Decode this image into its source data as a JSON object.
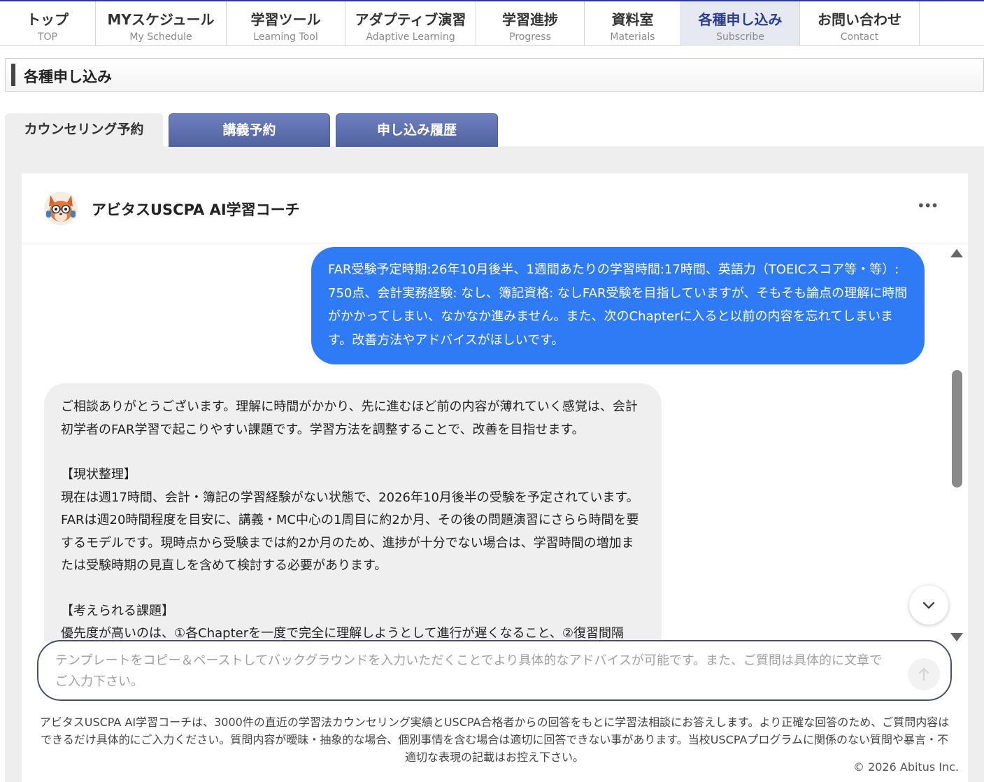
{
  "nav": {
    "items": [
      {
        "jp": "トップ",
        "en": "TOP",
        "active": false
      },
      {
        "jp": "MYスケジュール",
        "en": "My Schedule",
        "active": false
      },
      {
        "jp": "学習ツール",
        "en": "Learning Tool",
        "active": false
      },
      {
        "jp": "アダプティブ演習",
        "en": "Adaptive Learning",
        "active": false
      },
      {
        "jp": "学習進捗",
        "en": "Progress",
        "active": false
      },
      {
        "jp": "資料室",
        "en": "Materials",
        "active": false
      },
      {
        "jp": "各種申し込み",
        "en": "Subscribe",
        "active": true
      },
      {
        "jp": "お問い合わせ",
        "en": "Contact",
        "active": false
      }
    ]
  },
  "page": {
    "title": "各種申し込み"
  },
  "tabs": [
    {
      "label": "カウンセリング予約",
      "active": true
    },
    {
      "label": "講義予約",
      "active": false
    },
    {
      "label": "申し込み履歴",
      "active": false
    }
  ],
  "chat": {
    "bot_name": "アビタスUSCPA AI学習コーチ",
    "more_label": "•••",
    "avatar_icon": "fox-mascot-icon",
    "user_message": "FAR受験予定時期:26年10月後半、1週間あたりの学習時間:17時間、英語力（TOEICスコア等・等）: 750点、会計実務経験: なし、簿記資格: なしFAR受験を目指していますが、そもそも論点の理解に時間がかかってしまい、なかなか進みません。また、次のChapterに入ると以前の内容を忘れてしまいます。改善方法やアドバイスがほしいです。",
    "bot_message": {
      "intro": "ご相談ありがとうございます。理解に時間がかかり、先に進むほど前の内容が薄れていく感覚は、会計初学者のFAR学習で起こりやすい課題です。学習方法を調整することで、改善を目指せます。",
      "section1_title": "【現状整理】",
      "section1_body": "現在は週17時間、会計・簿記の学習経験がない状態で、2026年10月後半の受験を予定されています。FARは週20時間程度を目安に、講義・MC中心の1周目に約2か月、その後の問題演習にさらら時間を要するモデルです。現時点から受験までは約2か月のため、進捗が十分でない場合は、学習時間の増加または受験時期の見直しを含めて検討する必要があります。",
      "section2_title": "【考えられる課題】",
      "section2_body": "優先度が高いのは、①各Chapterを一度で完全に理解しようとして進行が遅くなること、②復習間隔"
    },
    "input": {
      "value": "",
      "placeholder": "テンプレートをコピー＆ペーストしてバックグラウンドを入力いただくことでより具体的なアドバイスが可能です。また、ご質問は具体的に文章でご入力下さい。"
    },
    "disclaimer": "アビタスUSCPA AI学習コーチは、3000件の直近の学習法カウンセリング実績とUSCPA合格者からの回答をもとに学習法相談にお答えします。より正確な回答のため、ご質問内容はできるだけ具体的にご入力ください。質問内容が曖昧・抽象的な場合、個別事情を含む場合は適切に回答できない事があります。当校USCPAプログラムに関係のない質問や暴言・不適切な表現の記載はお控え下さい。",
    "copyright": "© 2026 Abitus Inc."
  },
  "colors": {
    "brand_navy": "#2a3d8f",
    "tab_inactive": "#5e70ae",
    "user_bubble": "#2f7bf5",
    "bot_bubble": "#efefef"
  }
}
